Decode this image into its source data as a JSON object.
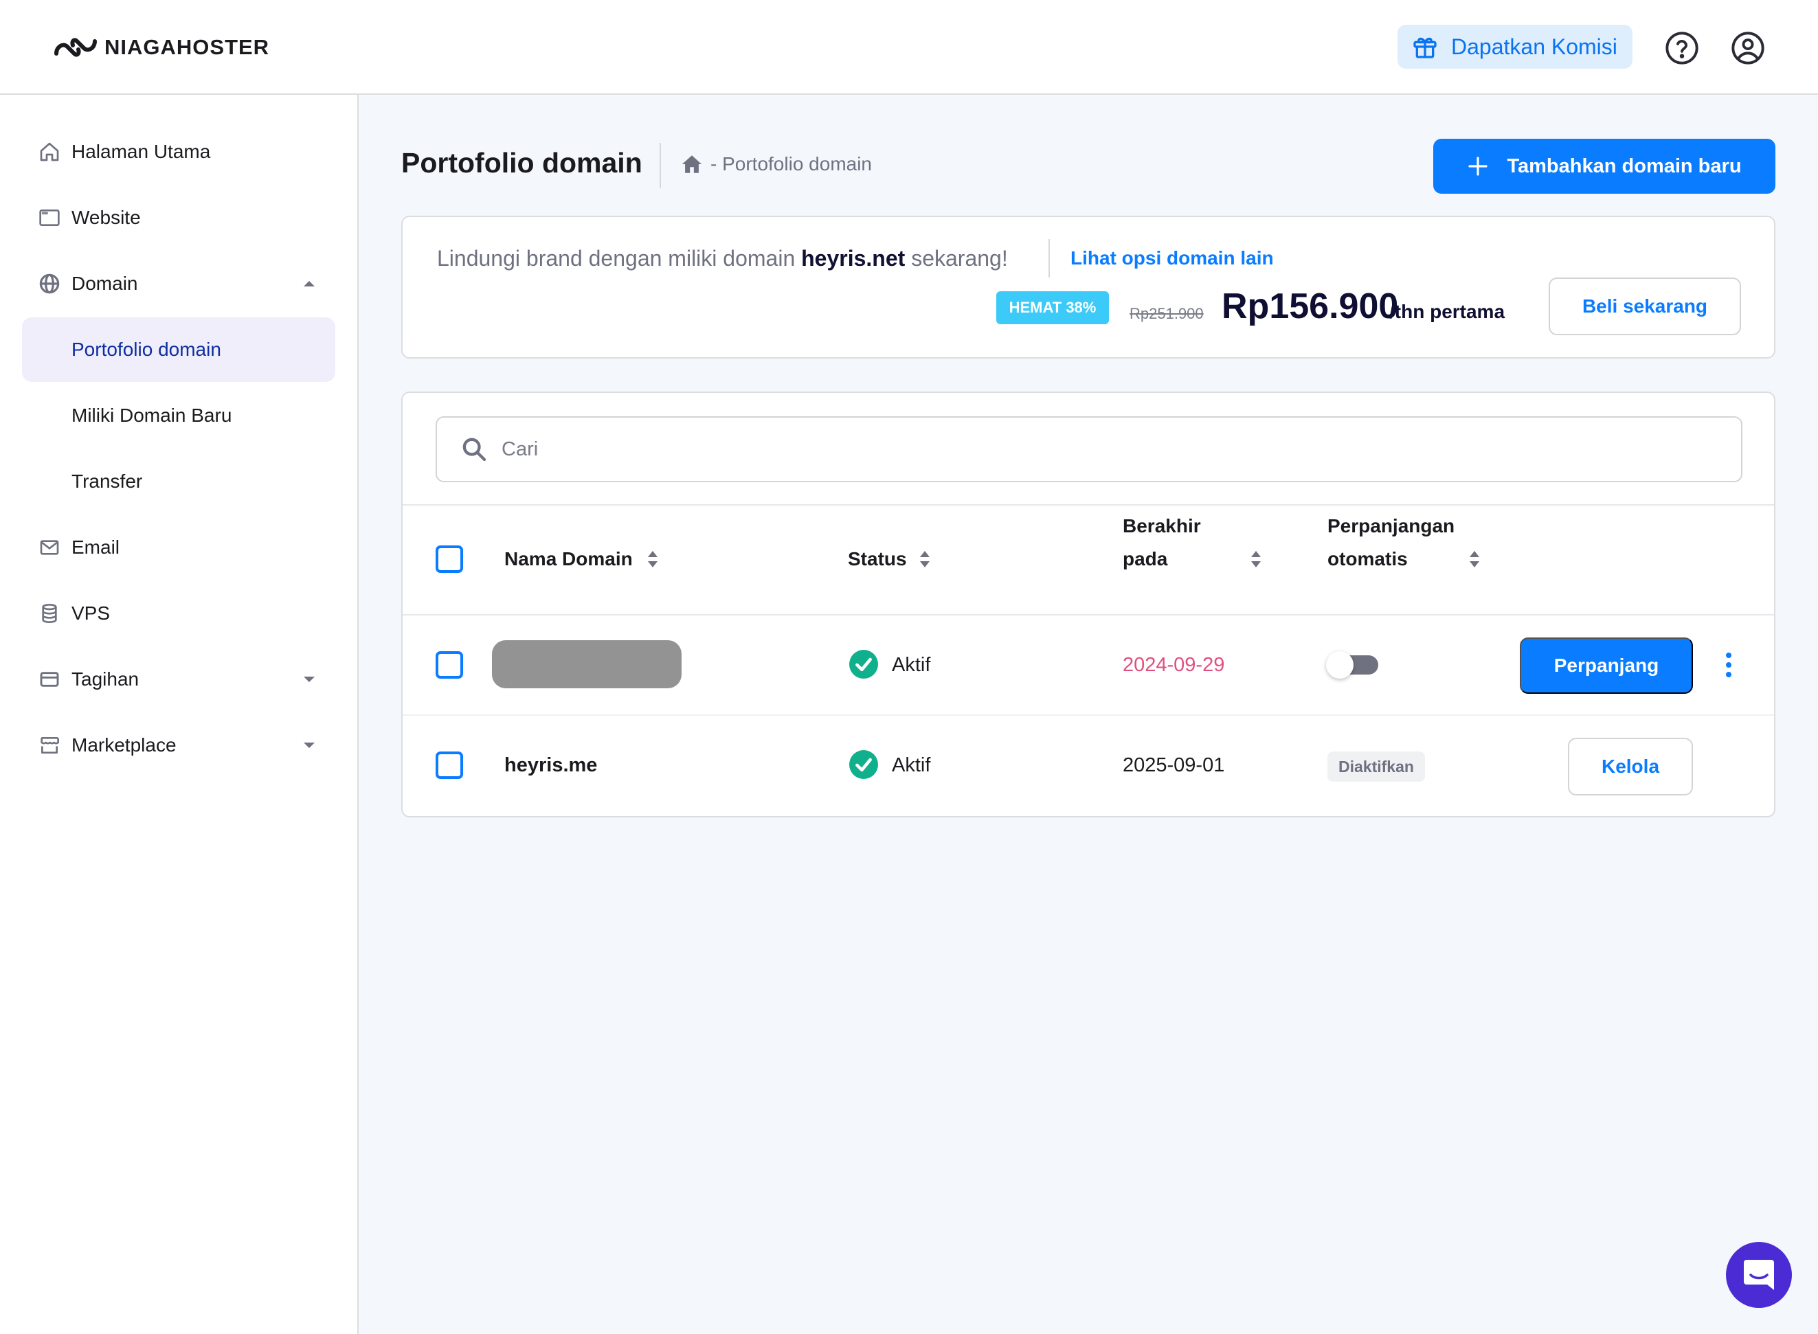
{
  "app": {
    "brand": "NIAGAHOSTER"
  },
  "header": {
    "commission_label": "Dapatkan Komisi",
    "help_icon": "question-circle-icon",
    "account_icon": "user-circle-icon"
  },
  "sidebar": {
    "items": [
      {
        "label": "Halaman Utama",
        "icon": "home-icon"
      },
      {
        "label": "Website",
        "icon": "browser-window-icon"
      },
      {
        "label": "Domain",
        "icon": "globe-icon",
        "expanded": true
      },
      {
        "label": "Portofolio domain",
        "active": true
      },
      {
        "label": "Miliki Domain Baru"
      },
      {
        "label": "Transfer"
      },
      {
        "label": "Email",
        "icon": "mail-icon"
      },
      {
        "label": "VPS",
        "icon": "database-icon"
      },
      {
        "label": "Tagihan",
        "icon": "credit-card-icon",
        "expanded": false
      },
      {
        "label": "Marketplace",
        "icon": "store-icon",
        "expanded": false
      }
    ]
  },
  "page": {
    "title": "Portofolio domain",
    "breadcrumb": "- Portofolio domain",
    "add_button": "Tambahkan domain baru"
  },
  "promo": {
    "text_before": "Lindungi brand dengan miliki domain ",
    "domain": "heyris.net",
    "text_after": " sekarang!",
    "link": "Lihat opsi domain lain",
    "badge": "HEMAT 38%",
    "old_price": "Rp251.900",
    "new_price": "Rp156.900",
    "period": "/thn pertama",
    "buy_button": "Beli sekarang"
  },
  "table": {
    "search_placeholder": "Cari",
    "search_value": "",
    "columns": {
      "name": "Nama Domain",
      "status": "Status",
      "expiry_line1": "Berakhir",
      "expiry_line2": "pada",
      "auto_line1": "Perpanjangan",
      "auto_line2": "otomatis"
    },
    "rows": [
      {
        "domain": "",
        "domain_redacted": true,
        "status": "Aktif",
        "expires": "2024-09-29",
        "expiring_soon": true,
        "auto_renew": false,
        "action": "Perpanjang"
      },
      {
        "domain": "heyris.me",
        "domain_redacted": false,
        "status": "Aktif",
        "expires": "2025-09-01",
        "expiring_soon": false,
        "auto_renew_label": "Diaktifkan",
        "action": "Kelola"
      }
    ]
  },
  "colors": {
    "primary": "#0a7cff",
    "active_nav_bg": "#f1eefc",
    "active_nav_text": "#0d2ea0",
    "status_active": "#10b08c",
    "expiring_date": "#e0507e",
    "badge_bg": "#3ccaf8",
    "chat_bg": "#4b2bd4"
  }
}
